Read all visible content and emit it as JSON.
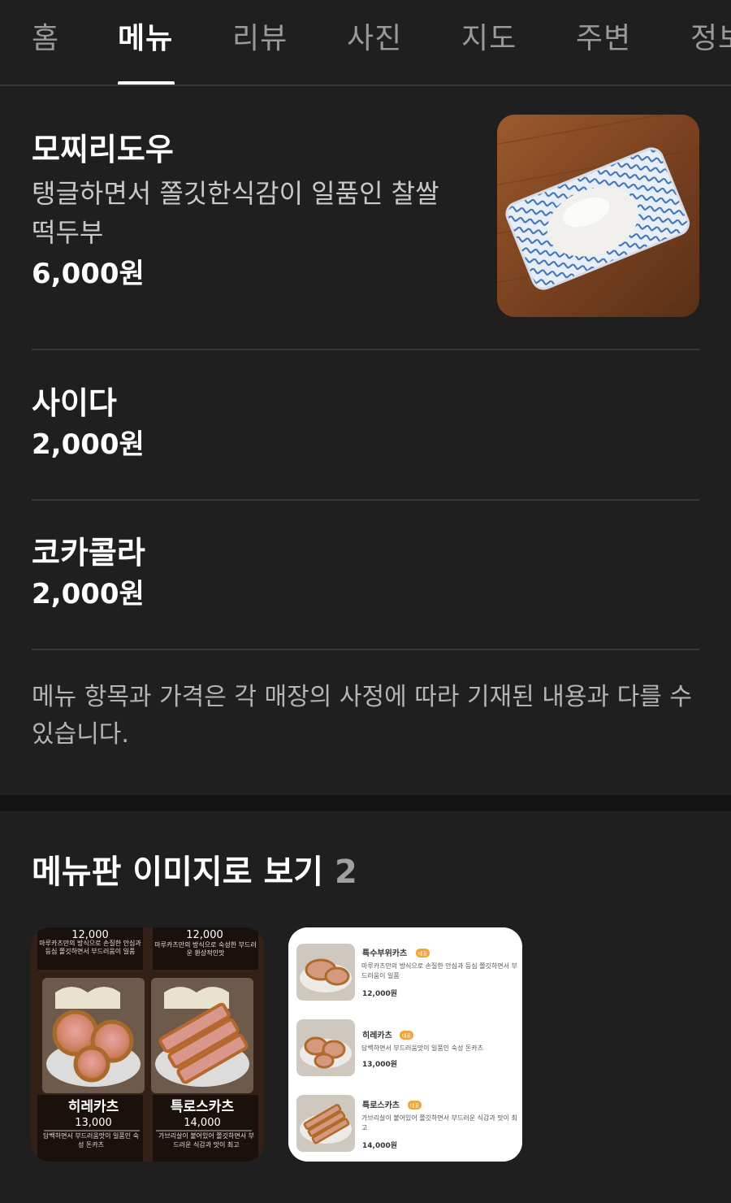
{
  "tabs": [
    {
      "label": "홈",
      "active": false
    },
    {
      "label": "메뉴",
      "active": true
    },
    {
      "label": "리뷰",
      "active": false
    },
    {
      "label": "사진",
      "active": false
    },
    {
      "label": "지도",
      "active": false
    },
    {
      "label": "주변",
      "active": false
    },
    {
      "label": "정보",
      "active": false
    }
  ],
  "menu_items": [
    {
      "name": "모찌리도우",
      "desc": "탱글하면서 쫄깃한식감이 일품인 찰쌀 떡두부",
      "price": "6,000원",
      "image": "rice-cake-tofu-photo"
    },
    {
      "name": "사이다",
      "price": "2,000원"
    },
    {
      "name": "코카콜라",
      "price": "2,000원"
    }
  ],
  "notice": "메뉴 항목과 가격은 각 매장의 사정에 따라 기재된 내용과 다를 수 있습니다.",
  "menu_board": {
    "title": "메뉴판 이미지로 보기",
    "count": "2",
    "board1": {
      "top_prices": [
        "12,000",
        "12,000"
      ],
      "top_descs": [
        "마루카츠만의 방식으로 손질한 안심과등심 쫄깃하면서 부드러움이 일품",
        "마루카츠만의 방식으로 숙성한 부드러운 환상적인맛"
      ],
      "dishes": [
        {
          "name": "히레카츠",
          "price": "13,000",
          "desc": "담백하면서 부드러움맛이 일품인 숙성 돈카츠"
        },
        {
          "name": "특로스카츠",
          "price": "14,000",
          "desc": "가브리살이 붙어있어 쫄깃하면서 부드러운 식감과 맛이 최고"
        }
      ]
    },
    "board2": {
      "badge": "대표",
      "items": [
        {
          "name": "특수부위카츠",
          "desc": "마루카츠만의 방식으로 손질한 안심과 등심 쫄깃하면서 부드러움이 일품",
          "price": "12,000원"
        },
        {
          "name": "히레카츠",
          "desc": "담백하면서 부드러움맛이 일품인 숙성 돈카츠",
          "price": "13,000원"
        },
        {
          "name": "특로스카츠",
          "desc": "가브리살이 붙어있어 쫄깃하면서 부드러운 식감과 맛이 최고",
          "price": "14,000원"
        }
      ]
    }
  },
  "colors": {
    "background": "#1f1f1f",
    "text": "#ffffff",
    "muted": "#9a9a9a",
    "divider": "#383838"
  }
}
